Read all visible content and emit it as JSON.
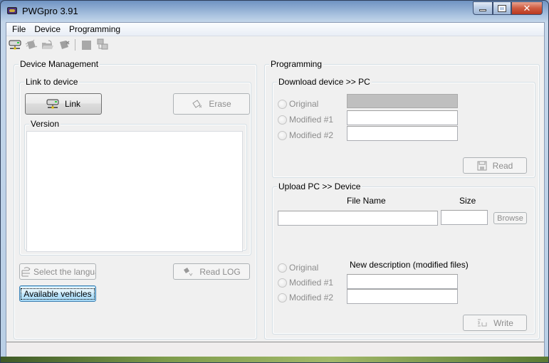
{
  "window": {
    "title": "PWGpro 3.91",
    "controls": {
      "minimize": "minimize",
      "maximize": "maximize",
      "close": "close"
    }
  },
  "menu": {
    "items": [
      {
        "label": "File"
      },
      {
        "label": "Device"
      },
      {
        "label": "Programming"
      }
    ]
  },
  "toolbar": {
    "icons": [
      "link-device-icon",
      "chip-icon",
      "open-folder-icon",
      "erase-chip-icon",
      "stop-icon",
      "network-computers-icon"
    ]
  },
  "device_management": {
    "title": "Device Management",
    "link_group": {
      "title": "Link to device",
      "link_button": "Link",
      "erase_button": "Erase",
      "version_group": {
        "title": "Version",
        "content": ""
      }
    },
    "select_language_button": "Select the language",
    "read_log_button": "Read LOG",
    "available_vehicles_button": "Available vehicles"
  },
  "programming": {
    "title": "Programming",
    "download": {
      "title": "Download device >> PC",
      "options": [
        {
          "label": "Original",
          "value": "",
          "disabled_field": true
        },
        {
          "label": "Modified #1",
          "value": ""
        },
        {
          "label": "Modified #2",
          "value": ""
        }
      ],
      "read_button": "Read"
    },
    "upload": {
      "title": "Upload PC >> Device",
      "file_name_label": "File Name",
      "size_label": "Size",
      "file_name_value": "",
      "size_value": "",
      "browse_button": "Browse",
      "new_description_label": "New description (modified files)",
      "options": [
        {
          "label": "Original"
        },
        {
          "label": "Modified #1",
          "value": ""
        },
        {
          "label": "Modified #2",
          "value": ""
        }
      ],
      "write_button": "Write"
    }
  },
  "status_bar": {
    "text": ""
  }
}
